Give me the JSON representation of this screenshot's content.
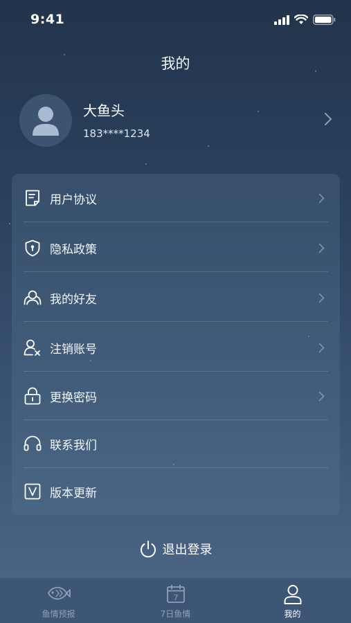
{
  "status_bar": {
    "time": "9:41"
  },
  "header": {
    "title": "我的"
  },
  "profile": {
    "name": "大鱼头",
    "phone": "183****1234"
  },
  "menu": {
    "items": [
      {
        "label": "用户协议",
        "icon": "document-icon",
        "has_chevron": true
      },
      {
        "label": "隐私政策",
        "icon": "shield-icon",
        "has_chevron": true
      },
      {
        "label": "我的好友",
        "icon": "friends-icon",
        "has_chevron": true
      },
      {
        "label": "注销账号",
        "icon": "user-remove-icon",
        "has_chevron": true
      },
      {
        "label": "更换密码",
        "icon": "lock-icon",
        "has_chevron": true
      },
      {
        "label": "联系我们",
        "icon": "headset-icon",
        "has_chevron": false
      },
      {
        "label": "版本更新",
        "icon": "version-icon",
        "has_chevron": false
      }
    ]
  },
  "logout": {
    "label": "退出登录",
    "icon": "power-icon"
  },
  "tab_bar": {
    "tabs": [
      {
        "label": "鱼情预报",
        "icon": "fish-icon",
        "active": false
      },
      {
        "label": "7日鱼情",
        "icon": "calendar-icon",
        "calendar_number": "7",
        "active": false
      },
      {
        "label": "我的",
        "icon": "person-icon",
        "active": true
      }
    ]
  },
  "colors": {
    "background_top": "#22344b",
    "background_bottom": "#4f6889",
    "tab_inactive": "#8fa1b8",
    "tab_active": "#ffffff"
  }
}
